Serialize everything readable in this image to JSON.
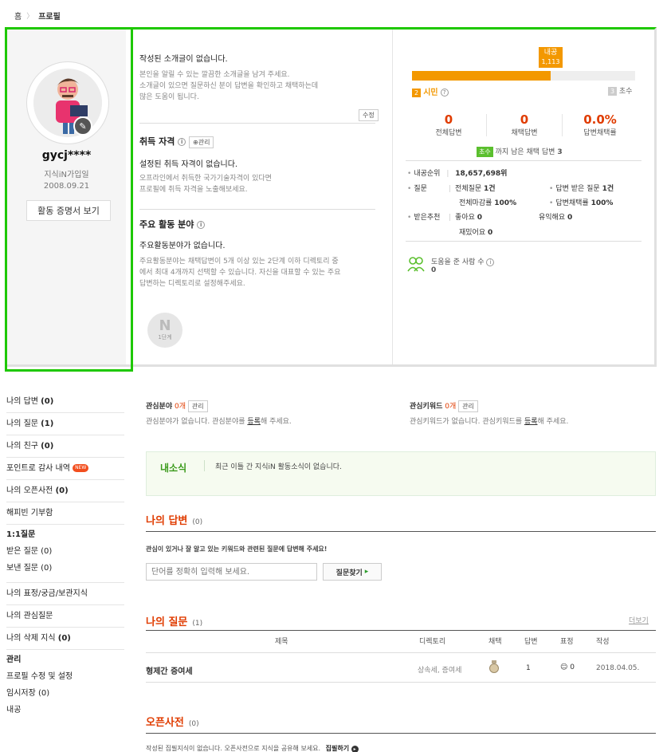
{
  "breadcrumb": {
    "home": "홈",
    "current": "프로필"
  },
  "profile": {
    "nickname": "gycj****",
    "joined_label": "지식iN가입일",
    "joined_date": "2008.09.21",
    "cert_button": "활동 증명서 보기",
    "intro": {
      "title": "작성된 소개글이 없습니다.",
      "desc1": "본인을 알릴 수 있는 깔끔한 소개글을 남겨 주세요.",
      "desc2": "소개글이 있으면 질문하신 분이 답변을 확인하고 채택하는데",
      "desc3": "많은 도움이 됩니다.",
      "edit_button": "수정"
    },
    "license": {
      "title": "취득 자격",
      "manage": "관리",
      "empty": "설정된 취득 자격이 없습니다.",
      "desc1": "오프라인에서 취득한 국가기술자격이 있다면",
      "desc2": "프로필에 취득 자격을 노출해보세요."
    },
    "field": {
      "title": "주요 활동 분야",
      "empty": "주요활동분야가 없습니다.",
      "desc1": "주요활동분야는 채택답변이 5개 이상 있는 2단계 이하 디렉토리 중",
      "desc2": "에서 최대 4개까지 선택할 수 있습니다. 자신을 대표할 수 있는 주요",
      "desc3": "답변하는 디렉토리로 설정해주세요."
    },
    "badge_label": "1단계"
  },
  "level": {
    "naegong_label": "내공",
    "naegong_value": "1,113",
    "progress": 0.62,
    "current_num": "2",
    "current_name": "시민",
    "next_num": "3",
    "next_name": "초수",
    "stats": [
      {
        "value": "0",
        "label": "전체답변"
      },
      {
        "value": "0",
        "label": "채택답변"
      },
      {
        "value": "0.0%",
        "label": "답변채택률"
      }
    ],
    "next_chip": "초수",
    "next_text": "까지 남은 채택 답변",
    "next_count": "3"
  },
  "activity": {
    "rank_label": "내공순위",
    "rank_value": "18,657,698위",
    "question_label": "질문",
    "q_total_label": "전체질문",
    "q_total": "1건",
    "q_answered_label": "답변 받은 질문",
    "q_answered": "1건",
    "q_close_label": "전체마감률",
    "q_close": "100%",
    "q_adopt_label": "답변채택률",
    "q_adopt": "100%",
    "rec_label": "받은추천",
    "like_label": "좋아요",
    "like": "0",
    "useful_label": "유익해요",
    "useful": "0",
    "fun_label": "재밌어요",
    "fun": "0",
    "helped_label": "도움을 준 사람 수",
    "helped": "0"
  },
  "nav": {
    "items": [
      {
        "label": "나의 답변",
        "count": "(0)"
      },
      {
        "label": "나의 질문",
        "count": "(1)"
      },
      {
        "label": "나의 친구",
        "count": "(0)"
      },
      {
        "label": "포인트로 감사 내역",
        "count": ""
      },
      {
        "label": "나의 오픈사전",
        "count": "(0)"
      },
      {
        "label": "해피빈 기부함",
        "count": ""
      }
    ],
    "new_badge": "NEW",
    "one_to_one": "1:1질문",
    "received": "받은 질문 (0)",
    "sent": "보낸 질문 (0)",
    "saved": "나의 표정/궁금/보관지식",
    "interest": "나의 관심질문",
    "deleted": "나의 삭제 지식",
    "deleted_count": "(0)",
    "manage": "관리",
    "profile_edit": "프로필 수정 및 설정",
    "temp": "임시저장 (0)",
    "naegong": "내공"
  },
  "interest": {
    "field_label": "관심분야",
    "field_count": "0개",
    "manage": "관리",
    "field_empty_a": "관심분야가 없습니다. 관심분야를 ",
    "register": "등록",
    "field_empty_b": "해 주세요.",
    "kw_label": "관심키워드",
    "kw_count": "0개",
    "kw_empty_a": "관심키워드가 없습니다. 관심키워드를 "
  },
  "news": {
    "title": "내소식",
    "text": "최근 이틀 간 지식iN 활동소식이 없습니다."
  },
  "my_answers": {
    "title": "나의 답변",
    "count": "(0)",
    "prompt": "관심이 있거나 잘 알고 있는 키워드와 관련된 질문에 답변해 주세요!",
    "placeholder": "단어를 정확히 입력해 보세요.",
    "button": "질문찾기"
  },
  "my_questions": {
    "title": "나의 질문",
    "count": "(1)",
    "more": "더보기",
    "columns": [
      "제목",
      "디렉토리",
      "채택",
      "답변",
      "표정",
      "작성"
    ],
    "rows": [
      {
        "title": "형제간 증여세",
        "dir": "상속세, 증여세",
        "answers": "1",
        "faces": "0",
        "date": "2018.04.05."
      }
    ]
  },
  "open_dict": {
    "title": "오픈사전",
    "count": "(0)",
    "text": "작성된 집필지식이 없습니다. 오픈사전으로 지식을 공유해 보세요.",
    "link": "집필하기"
  }
}
